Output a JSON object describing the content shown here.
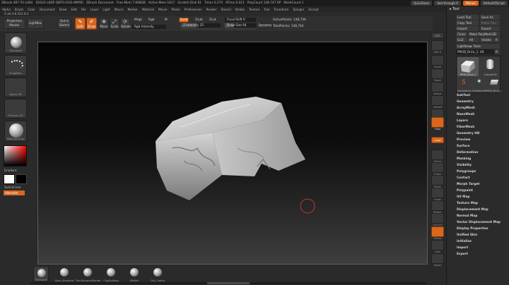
{
  "titlebar": {
    "items": [
      "ZBrush 4R7 P3 (x64)",
      "[DGU1-LKDF-QNTG-R1D-HMYB]",
      "ZBrush Document",
      "Free Mem 7.698GB",
      "Active Mem 1817",
      "Scratch Disk 91",
      "Timer 0.274",
      "ATime 0.011",
      "PolyCount 148.747 KP",
      "MeshCount 1"
    ],
    "quicksave": "QuickSave",
    "seethrough": "See-through  0",
    "menus": "Menus",
    "script": "DefaultZScript"
  },
  "menubar": [
    "Alpha",
    "Brush",
    "Color",
    "Document",
    "Draw",
    "Edit",
    "File",
    "Layer",
    "Light",
    "Macro",
    "Marker",
    "Material",
    "Movie",
    "Picker",
    "Preferences",
    "Render",
    "Stencil",
    "Stroke",
    "Texture",
    "Tool",
    "Transform",
    "Zplugin",
    "Zscript"
  ],
  "infostrip": "0.34 4.8.522.8.2",
  "toolbar": {
    "projection": "Projection Master",
    "lightbox": "LightBox",
    "quicksketch": "Quick Sketch",
    "edit": "Edit",
    "draw": "Draw",
    "move": "Move",
    "scale": "Scale",
    "rotate": "Rotate",
    "mrgb": "Mrgb",
    "rgb": "Rgb",
    "m": "M",
    "zadd": "Zadd",
    "zsub": "Zsub",
    "zcut": "Zcut",
    "rgb_intensity": "Rgb Intensity",
    "z_intensity": "Z Intensity 25",
    "focal_shift": "Focal Shift 0",
    "draw_size": "Draw Size 64",
    "dynamic": "Dynamic",
    "active_points": "ActivePoints: 148,744",
    "total_points": "TotalPoints: 148,744"
  },
  "leftshelf": {
    "items": [
      "Standard",
      "DragRect",
      "",
      "Alpha Off",
      "Texture Off",
      "MatCap Gray"
    ],
    "gradient": "Gradient",
    "switch_color": "SwitchColor",
    "alternate": "Alternate"
  },
  "rightshelf": {
    "items": [
      "BPR",
      "SPix 3",
      "Scroll",
      "Zoom",
      "Actual",
      "AAHalf",
      "Persp",
      "Floor",
      "Local",
      "Gizmo",
      "Frame",
      "Move",
      "Scale",
      "Rotate",
      "Line Fill",
      "Transp",
      "Solo",
      "Xpose"
    ]
  },
  "toolpanel": {
    "title": "Tool",
    "buttons": [
      "Load Tool",
      "Save As",
      "Copy Tool",
      "Paste Tool",
      "Import",
      "Export",
      "Clone",
      "Make PolyMesh3D",
      "GoZ",
      "All",
      "Visible",
      "R",
      "Lightbox► Tools"
    ],
    "current_tool": "PM3D_Brick_1. 48",
    "slider_value": "R",
    "tools": [
      "PM3D_Brick_1",
      "Cylinder3D",
      "SimpleBrush",
      "PolyMesh3D",
      "PM3D_Brick_1"
    ],
    "subpalettes": [
      "SubTool",
      "Geometry",
      "ArrayMesh",
      "NanoMesh",
      "Layers",
      "FiberMesh",
      "Geometry HD",
      "Preview",
      "Surface",
      "Deformation",
      "Masking",
      "Visibility",
      "Polygroups",
      "Contact",
      "Morph Target",
      "Polypaint",
      "UV Map",
      "Texture Map",
      "Displacement Map",
      "Normal Map",
      "Vector Displacement Map",
      "Display Properties",
      "Unified Skin",
      "Initialize",
      "Import",
      "Export"
    ]
  },
  "bottomshelf": {
    "brushes": [
      "Standard",
      "Dam_Standard",
      "TrimDynamicBorder",
      "ClayBuildup",
      "hPolish",
      "Orb_Cracks"
    ]
  },
  "colors": {
    "accent": "#d9661f",
    "background": "#2a2a2a",
    "canvas_top": "#050505",
    "canvas_bottom": "#3e3e3e",
    "cursor": "#c0392b"
  }
}
